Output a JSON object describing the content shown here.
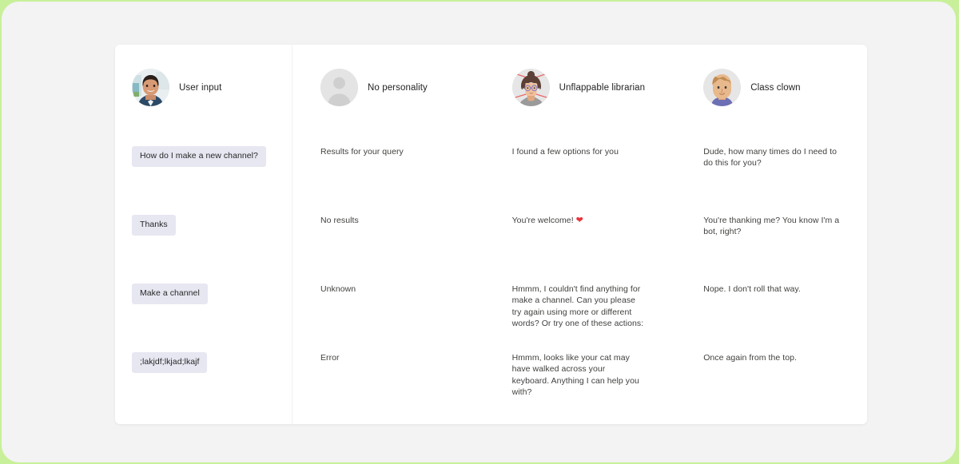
{
  "columns": [
    {
      "id": "user-input",
      "kind": "user",
      "avatar": "user-photo-avatar",
      "name": "User input",
      "messages": [
        ";lakjdf;lkjad;lkajf"
      ],
      "bubbles": [
        "How do I make a new channel?",
        "Thanks",
        "Make a channel",
        ";lakjdf;lkjad;lkajf"
      ]
    },
    {
      "id": "no-personality",
      "kind": "bot",
      "avatar": "default-person-avatar",
      "name": "No personality",
      "messages": [
        "Results for your query",
        "No results",
        "Unknown",
        "Error"
      ]
    },
    {
      "id": "unflappable-librarian",
      "kind": "bot",
      "avatar": "librarian-avatar",
      "name": "Unflappable librarian",
      "messages": [
        "I found a few options for you",
        "You're welcome! ",
        "Hmmm, I couldn't find anything for make a channel. Can you please try again using more or different words? Or try one of these actions:",
        "Hmmm, looks like your cat may have walked across your keyboard. Anything I can help you with?"
      ],
      "emoji": {
        "row": 1,
        "glyph": "❤",
        "name": "red-heart-emoji",
        "color": "#e8333a"
      }
    },
    {
      "id": "class-clown",
      "kind": "bot",
      "avatar": "class-clown-avatar",
      "name": "Class clown",
      "messages": [
        "Dude, how many times do I need to do this for you?",
        "You're thanking me? You know I'm a bot, right?",
        "Nope. I don't roll that way.",
        "Once again from the top."
      ]
    }
  ],
  "colors": {
    "frame": "#c8f09a",
    "page_background": "#f3f3f3",
    "card_background": "#ffffff",
    "user_bubble_background": "#e7e7f2",
    "user_bubble_text": "#272727",
    "bot_text": "#41413f",
    "divider": "#f0f0f2",
    "accent_heart": "#e8333a"
  }
}
